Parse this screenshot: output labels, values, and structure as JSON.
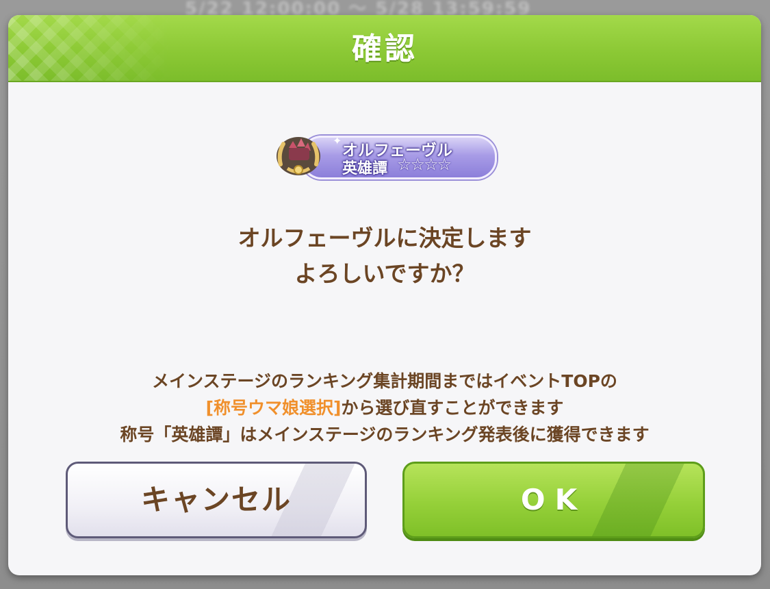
{
  "background": {
    "blurred_text": "5/22 12:00:00 〜 5/28 13:59:59"
  },
  "dialog": {
    "title": "確認",
    "badge": {
      "name": "オルフェーヴル",
      "rank": "英雄譚",
      "stars": "☆☆☆☆",
      "icon": "laurel-emblem-icon"
    },
    "message_lines": [
      "オルフェーヴルに決定します",
      "よろしいですか？"
    ],
    "note": {
      "line1": "メインステージのランキング集計期間まではイベントTOPの",
      "line2_highlight": "[称号ウマ娘選択]",
      "line2_rest": "から選び直すことができます",
      "line3": "称号「英雄譚」はメインステージのランキング発表後に獲得できます"
    },
    "buttons": {
      "cancel_label": "キャンセル",
      "ok_label": "OK"
    }
  },
  "colors": {
    "header_green": "#8cc935",
    "text_brown": "#6b4524",
    "highlight_orange": "#f0902c",
    "badge_purple": "#a79be6"
  }
}
